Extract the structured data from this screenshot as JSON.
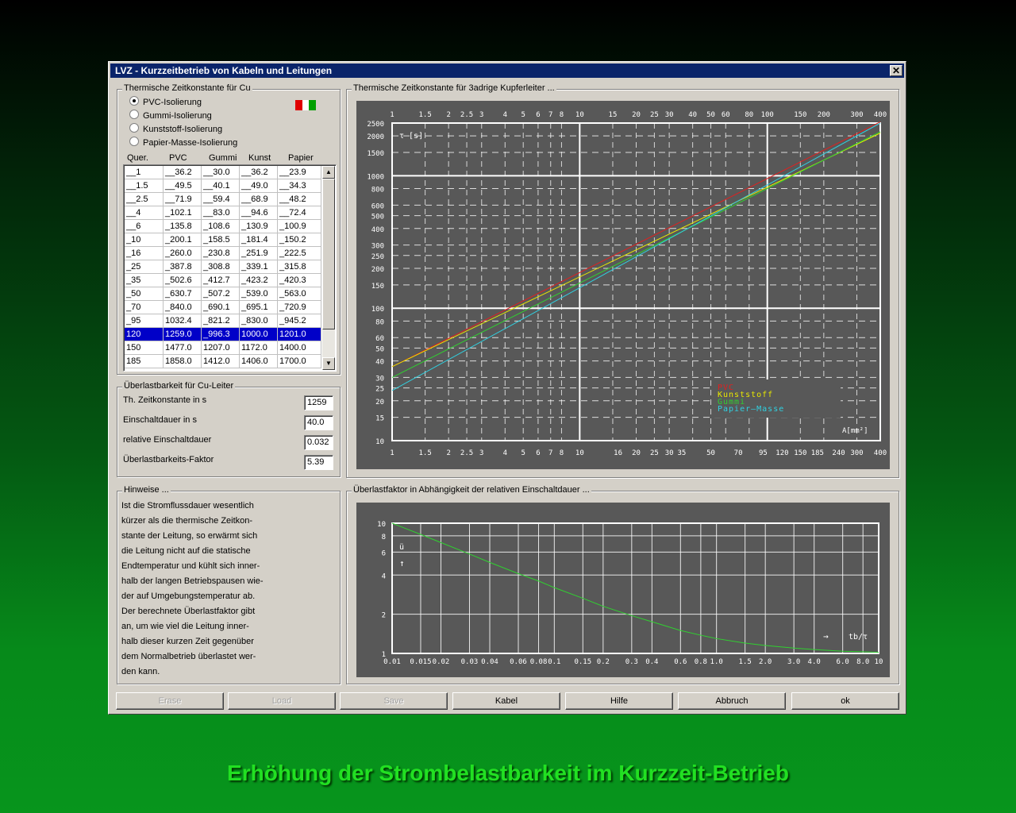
{
  "window": {
    "title": "LVZ - Kurzzeitbetrieb von Kabeln und Leitungen",
    "close": "✕"
  },
  "insulation": {
    "group_title": "Thermische Zeitkonstante für Cu",
    "options": [
      "PVC-Isolierung",
      "Gummi-Isolierung",
      "Kunststoff-Isolierung",
      "Papier-Masse-Isolierung"
    ],
    "selected": 0,
    "flag_colors": [
      "#e00000",
      "#ffffff",
      "#00a000"
    ]
  },
  "table": {
    "headers": [
      "Quer.",
      "PVC",
      "Gummi",
      "Kunst",
      "Papier"
    ],
    "rows": [
      [
        "__1",
        "__36.2",
        "__30.0",
        "__36.2",
        "__23.9"
      ],
      [
        "__1.5",
        "__49.5",
        "__40.1",
        "__49.0",
        "__34.3"
      ],
      [
        "__2.5",
        "__71.9",
        "__59.4",
        "__68.9",
        "__48.2"
      ],
      [
        "__4",
        "_102.1",
        "__83.0",
        "__94.6",
        "__72.4"
      ],
      [
        "__6",
        "_135.8",
        "_108.6",
        "_130.9",
        "_100.9"
      ],
      [
        "_10",
        "_200.1",
        "_158.5",
        "_181.4",
        "_150.2"
      ],
      [
        "_16",
        "_260.0",
        "_230.8",
        "_251.9",
        "_222.5"
      ],
      [
        "_25",
        "_387.8",
        "_308.8",
        "_339.1",
        "_315.8"
      ],
      [
        "_35",
        "_502.6",
        "_412.7",
        "_423.2",
        "_420.3"
      ],
      [
        "_50",
        "_630.7",
        "_507.2",
        "_539.0",
        "_563.0"
      ],
      [
        "_70",
        "_840.0",
        "_690.1",
        "_695.1",
        "_720.9"
      ],
      [
        "_95",
        "1032.4",
        "_821.2",
        "_830.0",
        "_945.2"
      ],
      [
        "120",
        "1259.0",
        "_996.3",
        "1000.0",
        "1201.0"
      ],
      [
        "150",
        "1477.0",
        "1207.0",
        "1172.0",
        "1400.0"
      ],
      [
        "185",
        "1858.0",
        "1412.0",
        "1406.0",
        "1700.0"
      ]
    ],
    "selected_row": 12
  },
  "overload": {
    "group_title": "Überlastbarkeit für Cu-Leiter",
    "fields": [
      {
        "label": "Th. Zeitkonstante in s",
        "value": "1259"
      },
      {
        "label": "Einschaltdauer in s",
        "value": "40.0"
      },
      {
        "label": "relative Einschaltdauer",
        "value": "0.032"
      },
      {
        "label": "Überlastbarkeits-Faktor",
        "value": "5.39"
      }
    ]
  },
  "hints": {
    "group_title": "Hinweise ...",
    "lines": [
      "Ist die Stromflussdauer wesentlich",
      "kürzer als die thermische Zeitkon-",
      "stante der Leitung, so erwärmt sich",
      "die Leitung nicht auf die statische",
      "Endtemperatur und kühlt sich inner-",
      "halb der langen Betriebspausen wie-",
      "der auf Umgebungstemperatur ab.",
      "Der berechnete Überlastfaktor gibt",
      "an, um wie viel die Leitung inner-",
      "halb dieser kurzen Zeit gegenüber",
      "dem Normalbetrieb überlastet wer-",
      "den kann."
    ]
  },
  "chart_data": [
    {
      "type": "line",
      "title": "Thermische Zeitkonstante für 3adrige Kupferleiter ...",
      "ylabel": "τ [s]",
      "xlabel": "A[mm²]",
      "xscale": "log",
      "yscale": "log",
      "xlim": [
        1,
        400
      ],
      "ylim": [
        10,
        2500
      ],
      "xticks_top": [
        "1",
        "1.5",
        "2",
        "2.5",
        "3",
        "4",
        "5",
        "6",
        "7",
        "8",
        "10",
        "15",
        "20",
        "25",
        "30",
        "40",
        "50",
        "60",
        "80",
        "100",
        "150",
        "200",
        "300",
        "400"
      ],
      "xticks_bottom": [
        "1",
        "1.5",
        "2",
        "2.5",
        "3",
        "4",
        "5",
        "6",
        "7",
        "8",
        "10",
        "16",
        "20",
        "25",
        "30",
        "35",
        "50",
        "70",
        "95",
        "120",
        "150",
        "185",
        "240",
        "300",
        "400"
      ],
      "yticks": [
        "10",
        "15",
        "20",
        "25",
        "30",
        "40",
        "50",
        "60",
        "80",
        "100",
        "150",
        "200",
        "250",
        "300",
        "400",
        "500",
        "600",
        "800",
        "1000",
        "1500",
        "2000",
        "2500"
      ],
      "legend_position": "bottom-right",
      "series": [
        {
          "name": "PVC",
          "color": "#e02020",
          "x": [
            1,
            400
          ],
          "y": [
            36.2,
            2550
          ]
        },
        {
          "name": "Kunststoff",
          "color": "#e8e800",
          "x": [
            1,
            400
          ],
          "y": [
            36.2,
            2100
          ]
        },
        {
          "name": "Gummi",
          "color": "#30d030",
          "x": [
            1,
            400
          ],
          "y": [
            30.0,
            2150
          ]
        },
        {
          "name": "Papier—Masse",
          "color": "#30d0e0",
          "x": [
            1,
            400
          ],
          "y": [
            23.9,
            2500
          ]
        }
      ]
    },
    {
      "type": "line",
      "title": "Überlastfaktor in Abhängigkeit der relativen Einschaltdauer ...",
      "ylabel": "ü",
      "xlabel": "tb/τ",
      "xscale": "log",
      "yscale": "log",
      "xlim": [
        0.01,
        10
      ],
      "ylim": [
        1,
        10
      ],
      "xticks": [
        "0.01",
        "0.015",
        "0.02",
        "0.03",
        "0.04",
        "0.06",
        "0.08",
        "0.1",
        "0.15",
        "0.2",
        "0.3",
        "0.4",
        "0.6",
        "0.8",
        "1.0",
        "1.5",
        "2.0",
        "3.0",
        "4.0",
        "6.0",
        "8.0",
        "10"
      ],
      "yticks": [
        "1",
        "2",
        "4",
        "6",
        "8",
        "10"
      ],
      "series": [
        {
          "name": "",
          "color": "#30d030",
          "x": [
            0.01,
            0.015,
            0.02,
            0.03,
            0.04,
            0.06,
            0.08,
            0.1,
            0.15,
            0.2,
            0.3,
            0.4,
            0.6,
            0.8,
            1.0,
            1.5,
            2.0,
            3.0,
            4.0,
            6.0,
            8.0,
            10
          ],
          "y": [
            10.0,
            8.2,
            7.1,
            5.8,
            5.0,
            4.1,
            3.6,
            3.2,
            2.65,
            2.3,
            1.95,
            1.75,
            1.5,
            1.38,
            1.3,
            1.2,
            1.15,
            1.1,
            1.07,
            1.04,
            1.03,
            1.02
          ]
        }
      ]
    }
  ],
  "buttons": [
    {
      "label": "Erase",
      "enabled": false
    },
    {
      "label": "Load",
      "enabled": false
    },
    {
      "label": "Save",
      "enabled": false
    },
    {
      "label": "Kabel",
      "enabled": true
    },
    {
      "label": "Hilfe",
      "enabled": true
    },
    {
      "label": "Abbruch",
      "enabled": true
    },
    {
      "label": "ok",
      "enabled": true
    }
  ],
  "footer": "Erhöhung der Strombelastbarkeit im Kurzzeit-Betrieb"
}
